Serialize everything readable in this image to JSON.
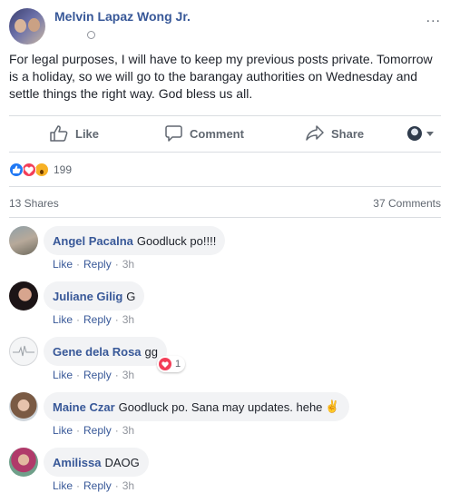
{
  "post": {
    "author": "Melvin Lapaz Wong Jr.",
    "privacy_icon": "globe-icon",
    "text": "For legal purposes, I will have to keep my previous posts private. Tomorrow is a holiday, so we will go to the barangay authorities on Wednesday and settle things the right way. God bless us all.",
    "more_icon": "..."
  },
  "actions": {
    "like": "Like",
    "comment": "Comment",
    "share": "Share"
  },
  "reactions": {
    "types": [
      "like",
      "love",
      "wow"
    ],
    "count": "199"
  },
  "stats": {
    "shares": "13 Shares",
    "comments": "37 Comments"
  },
  "comments": [
    {
      "author": "Angel Pacalna",
      "text": "Goodluck po!!!!",
      "like": "Like",
      "reply": "Reply",
      "sep": "·",
      "time": "3h"
    },
    {
      "author": "Juliane Gilig",
      "text": "G",
      "like": "Like",
      "reply": "Reply",
      "sep": "·",
      "time": "3h"
    },
    {
      "author": "Gene dela Rosa",
      "text": "gg",
      "like": "Like",
      "reply": "Reply",
      "sep": "·",
      "time": "3h",
      "reaction_count": "1"
    },
    {
      "author": "Maine Czar",
      "text": "Goodluck po. Sana may updates. hehe",
      "emoji": "✌",
      "like": "Like",
      "reply": "Reply",
      "sep": "·",
      "time": "3h"
    },
    {
      "author": "Amilissa",
      "text": "DAOG",
      "like": "Like",
      "reply": "Reply",
      "sep": "·",
      "time": "3h"
    }
  ],
  "colors": {
    "link": "#385898",
    "meta": "#606770",
    "like_blue": "#2078f4",
    "love_red": "#f33e58",
    "wow_yellow": "#f7b125",
    "bubble": "#f2f3f5"
  }
}
